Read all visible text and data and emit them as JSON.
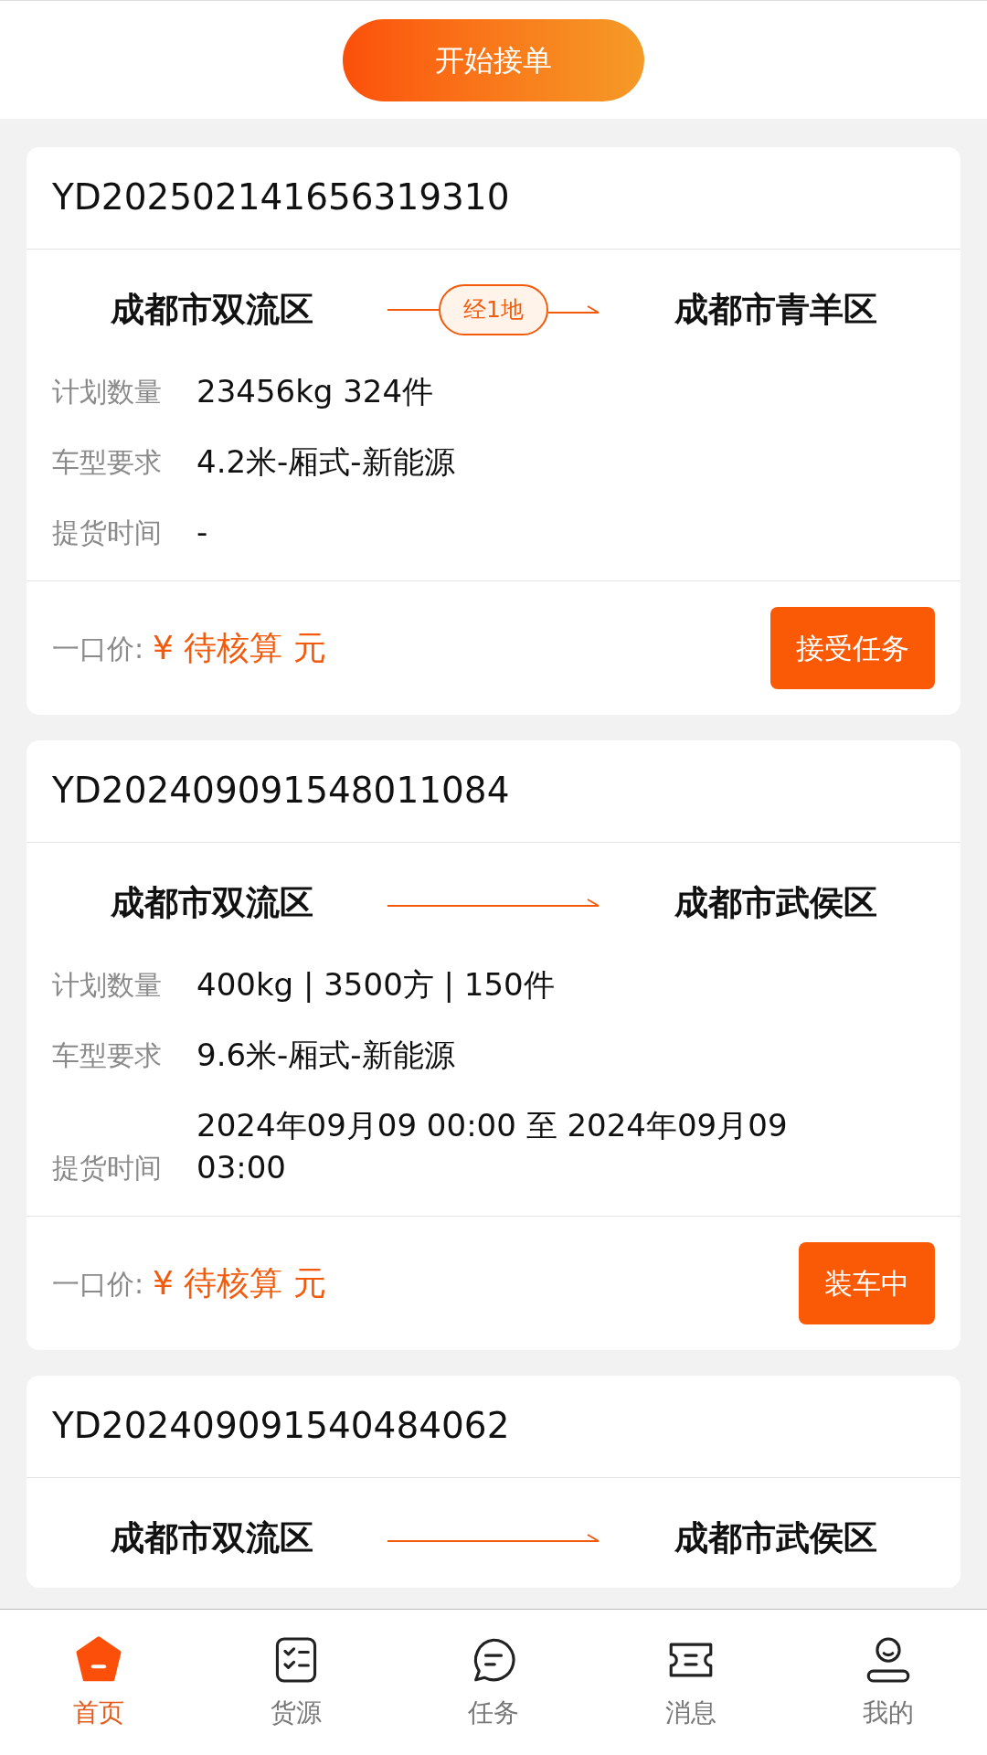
{
  "start_button": "开始接单",
  "orders": [
    {
      "id": "YD202502141656319310",
      "from": "成都市双流区",
      "via": "经1地",
      "to": "成都市青羊区",
      "details": [
        {
          "label": "计划数量",
          "value": "23456kg 324件"
        },
        {
          "label": "车型要求",
          "value": "4.2米-厢式-新能源"
        },
        {
          "label": "提货时间",
          "value": "-"
        }
      ],
      "price_label": "一口价:",
      "price": "¥ 待核算 元",
      "action": "接受任务"
    },
    {
      "id": "YD202409091548011084",
      "from": "成都市双流区",
      "to": "成都市武侯区",
      "details": [
        {
          "label": "计划数量",
          "value": "400kg | 3500方 | 150件"
        },
        {
          "label": "车型要求",
          "value": "9.6米-厢式-新能源"
        },
        {
          "label": "提货时间",
          "value": "2024年09月09 00:00 至 2024年09月09 03:00"
        }
      ],
      "price_label": "一口价:",
      "price": "¥ 待核算 元",
      "action": "装车中"
    },
    {
      "id": "YD202409091540484062",
      "from": "成都市双流区",
      "to": "成都市武侯区"
    }
  ],
  "tabs": [
    {
      "label": "首页",
      "kind": "home",
      "selected": true
    },
    {
      "label": "货源",
      "kind": "list",
      "selected": false
    },
    {
      "label": "任务",
      "kind": "chat",
      "selected": false
    },
    {
      "label": "消息",
      "kind": "ticket",
      "selected": false
    },
    {
      "label": "我的",
      "kind": "user",
      "selected": false
    }
  ]
}
